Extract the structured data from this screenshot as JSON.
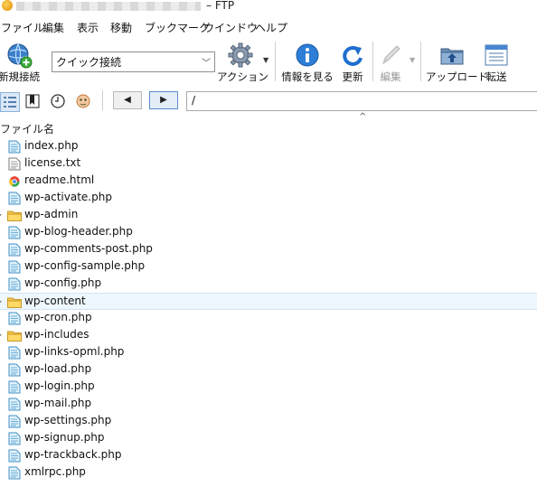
{
  "window": {
    "title": "– FTP"
  },
  "menu": [
    "ファイル",
    "編集",
    "表示",
    "移動",
    "ブックマーク",
    "ウインドウ",
    "ヘルプ"
  ],
  "toolbar": {
    "new_connection": "新規接続",
    "quick_connect": "クイック接続",
    "action": "アクション",
    "info": "情報を見る",
    "refresh": "更新",
    "edit": "編集",
    "upload": "アップロード",
    "transfers": "転送"
  },
  "nav": {
    "back": "◀",
    "forward": "▶",
    "path": "/"
  },
  "list": {
    "column_header": "ファイル名",
    "sort_indicator": "^",
    "files": [
      {
        "name": "index.php",
        "type": "php"
      },
      {
        "name": "license.txt",
        "type": "txt"
      },
      {
        "name": "readme.html",
        "type": "html"
      },
      {
        "name": "wp-activate.php",
        "type": "php"
      },
      {
        "name": "wp-admin",
        "type": "folder"
      },
      {
        "name": "wp-blog-header.php",
        "type": "php"
      },
      {
        "name": "wp-comments-post.php",
        "type": "php"
      },
      {
        "name": "wp-config-sample.php",
        "type": "php"
      },
      {
        "name": "wp-config.php",
        "type": "php"
      },
      {
        "name": "wp-content",
        "type": "folder",
        "selected": true
      },
      {
        "name": "wp-cron.php",
        "type": "php"
      },
      {
        "name": "wp-includes",
        "type": "folder"
      },
      {
        "name": "wp-links-opml.php",
        "type": "php"
      },
      {
        "name": "wp-load.php",
        "type": "php"
      },
      {
        "name": "wp-login.php",
        "type": "php"
      },
      {
        "name": "wp-mail.php",
        "type": "php"
      },
      {
        "name": "wp-settings.php",
        "type": "php"
      },
      {
        "name": "wp-signup.php",
        "type": "php"
      },
      {
        "name": "wp-trackback.php",
        "type": "php"
      },
      {
        "name": "xmlrpc.php",
        "type": "php"
      }
    ]
  }
}
